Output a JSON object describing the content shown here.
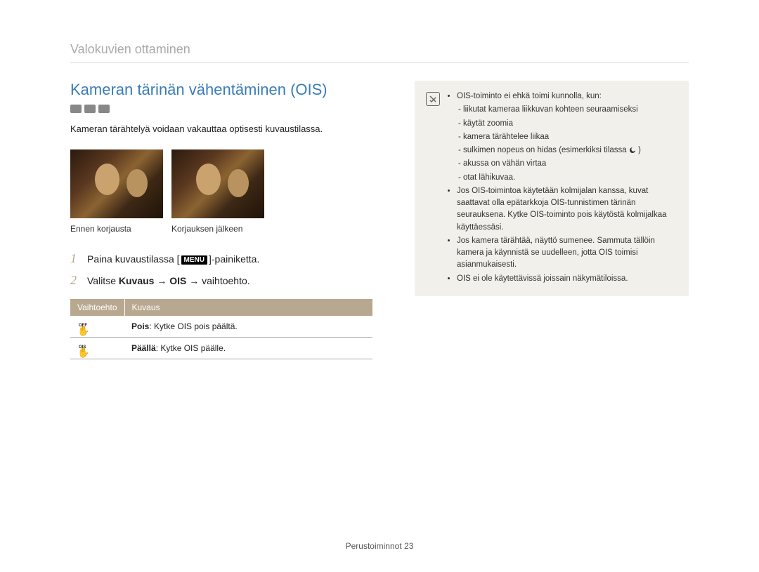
{
  "breadcrumb": "Valokuvien ottaminen",
  "title": "Kameran tärinän vähentäminen (OIS)",
  "intro": "Kameran tärähtelyä voidaan vakauttaa optisesti kuvaustilassa.",
  "image_labels": {
    "before": "Ennen korjausta",
    "after": "Korjauksen jälkeen"
  },
  "steps": [
    {
      "num": "1",
      "prefix": "Paina kuvaustilassa [",
      "button": "MENU",
      "suffix": "]-painiketta."
    },
    {
      "num": "2",
      "prefix": "Valitse ",
      "bold1": "Kuvaus",
      "mid": " → ",
      "bold2": "OIS",
      "suffix": " → vaihtoehto."
    }
  ],
  "table": {
    "headers": {
      "option": "Vaihtoehto",
      "desc": "Kuvaus"
    },
    "rows": [
      {
        "icon_label": "OFF",
        "bold": "Pois",
        "text": ": Kytke OIS pois päältä."
      },
      {
        "icon_label": "OIS",
        "bold": "Päällä",
        "text": ": Kytke OIS päälle."
      }
    ]
  },
  "notes": {
    "intro": "OIS-toiminto ei ehkä toimi kunnolla, kun:",
    "sublist": [
      "liikutat kameraa liikkuvan kohteen seuraamiseksi",
      "käytät zoomia",
      "kamera tärähtelee liikaa",
      "sulkimen nopeus on hidas (esimerkiksi tilassa ",
      "akussa on vähän virtaa",
      "otat lähikuvaa."
    ],
    "sublist_moon_index": 3,
    "items": [
      "Jos OIS-toimintoa käytetään kolmijalan kanssa, kuvat saattavat olla epätarkkoja OIS-tunnistimen tärinän seurauksena. Kytke OIS-toiminto pois käytöstä kolmijalkaa käyttäessäsi.",
      "Jos kamera tärähtää, näyttö sumenee. Sammuta tällöin kamera ja käynnistä se uudelleen, jotta OIS toimisi asianmukaisesti.",
      "OIS ei ole käytettävissä joissain näkymätiloissa."
    ]
  },
  "footer": {
    "section": "Perustoiminnot",
    "page": "23"
  }
}
